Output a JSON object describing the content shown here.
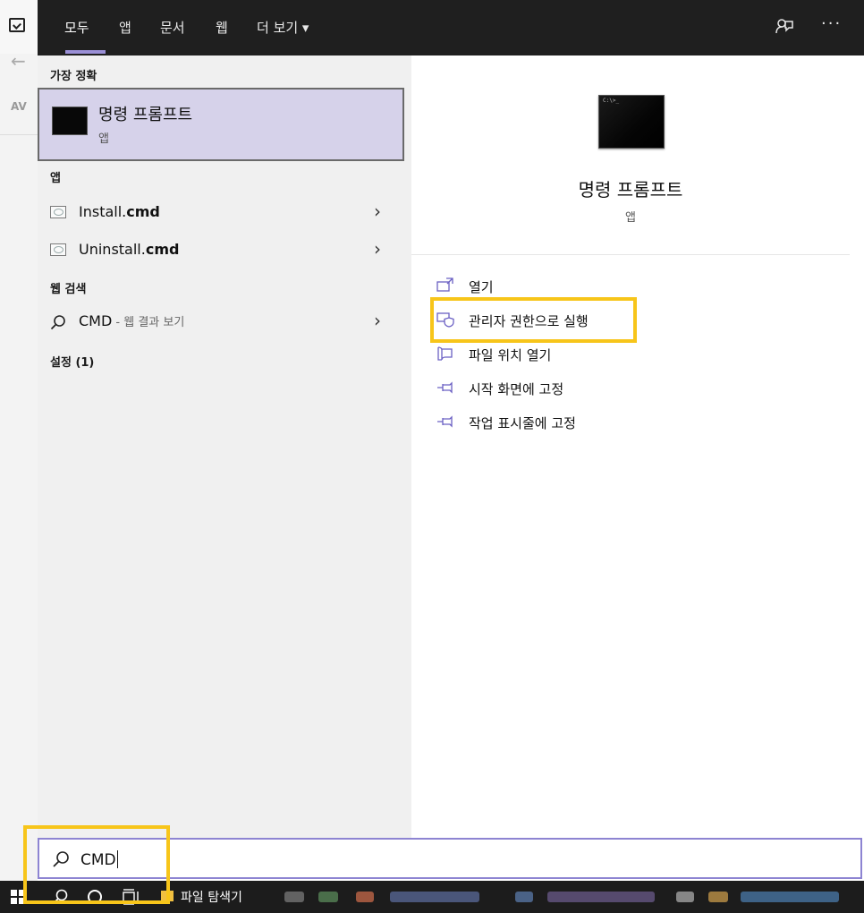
{
  "background_app": {
    "text": "AV"
  },
  "header": {
    "tabs": [
      {
        "label": "모두",
        "active": true
      },
      {
        "label": "앱",
        "active": false
      },
      {
        "label": "문서",
        "active": false
      },
      {
        "label": "웹",
        "active": false
      },
      {
        "label": "더 보기 ▾",
        "active": false
      }
    ],
    "feedback_icon": "feedback-icon",
    "more_icon": "ellipsis-icon",
    "more_glyph": "···"
  },
  "left": {
    "best_match_title": "가장 정확",
    "best_match": {
      "name": "명령 프롬프트",
      "type": "앱"
    },
    "apps_title": "앱",
    "apps": [
      {
        "prefix": "Install.",
        "bold": "cmd"
      },
      {
        "prefix": "Uninstall.",
        "bold": "cmd"
      }
    ],
    "web_title": "웹 검색",
    "web": {
      "query": "CMD",
      "hint": " - 웹 결과 보기"
    },
    "settings_title": "설정 (1)",
    "chevron": "›"
  },
  "preview": {
    "title": "명령 프롬프트",
    "subtitle": "앱",
    "actions": [
      {
        "label": "열기",
        "icon": "open-icon"
      },
      {
        "label": "관리자 권한으로 실행",
        "icon": "admin-shield-icon"
      },
      {
        "label": "파일 위치 열기",
        "icon": "folder-icon"
      },
      {
        "label": "시작 화면에 고정",
        "icon": "pin-icon"
      },
      {
        "label": "작업 표시줄에 고정",
        "icon": "pin-icon"
      }
    ]
  },
  "search": {
    "value": "CMD"
  },
  "taskbar": {
    "explorer_label": "파일 탐색기"
  },
  "colors": {
    "accent": "#8d84d2",
    "selection": "#d6d2ea",
    "highlight": "#f7c51a",
    "header_bg": "#1f1f1f"
  }
}
